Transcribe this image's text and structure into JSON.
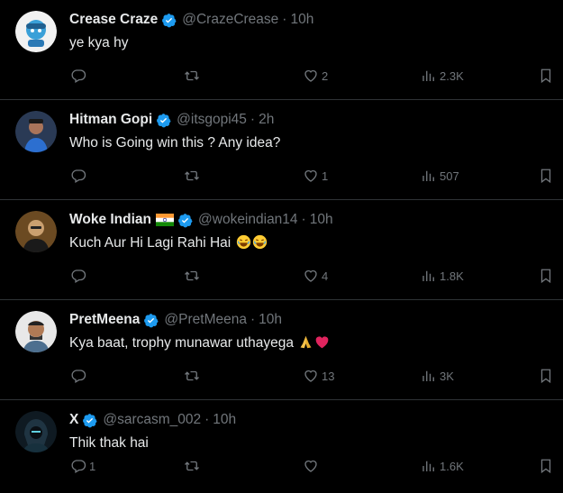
{
  "colors": {
    "background": "#000000",
    "text": "#e7e9ea",
    "muted": "#71767b",
    "verified": "#1d9bf0",
    "divider": "#2f3336"
  },
  "tweets": [
    {
      "name": "Crease Craze",
      "handle": "@CrazeCrease",
      "time": "10h",
      "text": "ye kya hy",
      "replies": "",
      "retweets": "",
      "likes": "2",
      "views": "2.3K",
      "flag": false
    },
    {
      "name": "Hitman Gopi",
      "handle": "@itsgopi45",
      "time": "2h",
      "text": "Who is Going win this ? Any idea?",
      "replies": "",
      "retweets": "",
      "likes": "1",
      "views": "507",
      "flag": false
    },
    {
      "name": "Woke Indian",
      "handle": "@wokeindian14",
      "time": "10h",
      "text": "Kuch Aur Hi Lagi Rahi Hai",
      "replies": "",
      "retweets": "",
      "likes": "4",
      "views": "1.8K",
      "flag": true
    },
    {
      "name": "PretMeena",
      "handle": "@PretMeena",
      "time": "10h",
      "text": "Kya baat, trophy munawar uthayega",
      "replies": "",
      "retweets": "",
      "likes": "13",
      "views": "3K",
      "flag": false
    },
    {
      "name": "X",
      "handle": "@sarcasm_002",
      "time": "10h",
      "text": "Thik thak hai",
      "replies": "1",
      "retweets": "",
      "likes": "",
      "views": "1.6K",
      "flag": false
    }
  ],
  "separator": "·",
  "icons": [
    "reply-icon",
    "retweet-icon",
    "like-icon",
    "views-icon",
    "bookmark-icon",
    "verified-icon"
  ]
}
